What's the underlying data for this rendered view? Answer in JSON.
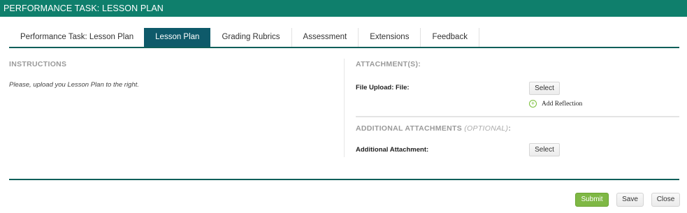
{
  "window": {
    "title": "PERFORMANCE TASK: LESSON PLAN"
  },
  "tabs": [
    {
      "label": "Performance Task: Lesson Plan",
      "active": false
    },
    {
      "label": "Lesson Plan",
      "active": true
    },
    {
      "label": "Grading Rubrics",
      "active": false
    },
    {
      "label": "Assessment",
      "active": false
    },
    {
      "label": "Extensions",
      "active": false
    },
    {
      "label": "Feedback",
      "active": false
    }
  ],
  "instructions": {
    "heading": "INSTRUCTIONS",
    "text": "Please, upload you Lesson Plan to the right."
  },
  "attachments": {
    "heading": "ATTACHMENT(S):",
    "file_upload_label": "File Upload: File:",
    "select_label": "Select",
    "add_reflection_label": "Add Reflection",
    "add_reflection_icon": "plus-circle-icon"
  },
  "additional": {
    "heading": "ADDITIONAL ATTACHMENTS",
    "optional": "(OPTIONAL)",
    "colon": ":",
    "attachment_label": "Additional Attachment:",
    "select_label": "Select"
  },
  "footer": {
    "submit_label": "Submit",
    "save_label": "Save",
    "close_label": "Close"
  },
  "colors": {
    "header_bg": "#0f7f6c",
    "active_tab_bg": "#0e5a6a",
    "submit_bg": "#7fb845"
  }
}
